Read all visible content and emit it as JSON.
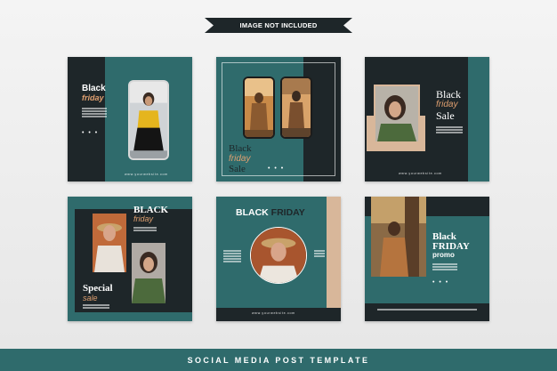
{
  "banner": {
    "text": "IMAGE NOT INCLUDED"
  },
  "footer": {
    "text": "SOCIAL MEDIA POST TEMPLATE"
  },
  "templates": {
    "t1": {
      "line1": "Black",
      "line2": "friday",
      "dots": "• • •",
      "url": "www.yourwebsite.com"
    },
    "t2": {
      "line1": "Black",
      "line2": "friday",
      "line3": "Sale",
      "dots": "• • •"
    },
    "t3": {
      "line1": "Black",
      "line2": "friday",
      "line3": "Sale",
      "url": "www.yourwebsite.com"
    },
    "t4": {
      "line1": "BLACK",
      "line2": "friday",
      "line3": "Special",
      "line4": "sale"
    },
    "t5": {
      "title_black": "BLACK",
      "title_friday": "FRIDAY",
      "url": "www.yourwebsite.com"
    },
    "t6": {
      "line1": "Black",
      "line2": "FRIDAY",
      "line3": "promo",
      "dots": "• • •"
    }
  },
  "colors": {
    "dark": "#1e2629",
    "teal": "#2f6b6c",
    "tan": "#d8b79a",
    "orange": "#e0a070"
  }
}
